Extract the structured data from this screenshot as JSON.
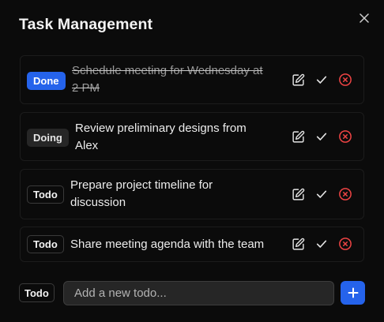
{
  "dialog": {
    "title": "Task Management",
    "close_icon": "close-icon"
  },
  "tasks": [
    {
      "status": "Done",
      "text_line1": "Schedule meeting for Wednesday at",
      "text_line2": "2 PM",
      "completed": true
    },
    {
      "status": "Doing",
      "text_line1": "Review preliminary designs from",
      "text_line2": "Alex",
      "completed": false
    },
    {
      "status": "Todo",
      "text_line1": "Prepare project timeline for",
      "text_line2": "discussion",
      "completed": false
    },
    {
      "status": "Todo",
      "text_line1": "Share meeting agenda with the team",
      "text_line2": "",
      "completed": false
    }
  ],
  "task_action_icons": [
    "edit-icon",
    "check-icon",
    "delete-circle-x-icon"
  ],
  "new_todo": {
    "status": "Todo",
    "value": "",
    "placeholder": "Add a new todo...",
    "add_icon": "plus-icon"
  },
  "colors": {
    "accent_blue": "#2563eb",
    "delete_red": "#ef4444",
    "background": "#0b0b0b",
    "card_border": "#1c1c1c"
  }
}
